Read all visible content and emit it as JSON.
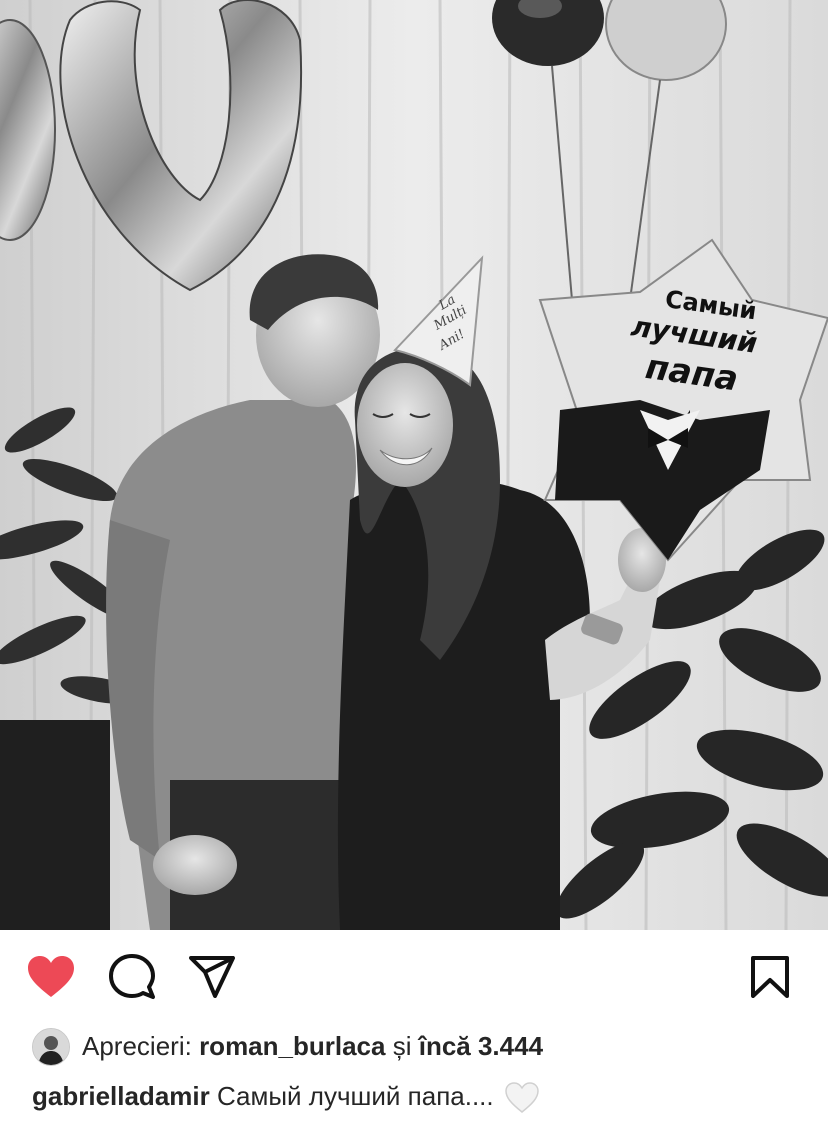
{
  "post": {
    "photo_alt": "",
    "balloon_text": [
      "Самый",
      "лучший",
      "папа"
    ],
    "hat_text": [
      "La",
      "Mulți",
      "Ani!"
    ]
  },
  "actions": {
    "like_state": "liked",
    "like_color": "#ed4956",
    "icons": [
      "heart-icon",
      "comment-icon",
      "share-icon",
      "bookmark-icon"
    ]
  },
  "likes": {
    "prefix": "Aprecieri:",
    "user": "roman_burlaca",
    "connector": "și",
    "more_label": "încă 3.444"
  },
  "caption": {
    "username": "gabrielladamir",
    "text": "Самый лучший папа....",
    "emoji": "white-heart-icon"
  }
}
